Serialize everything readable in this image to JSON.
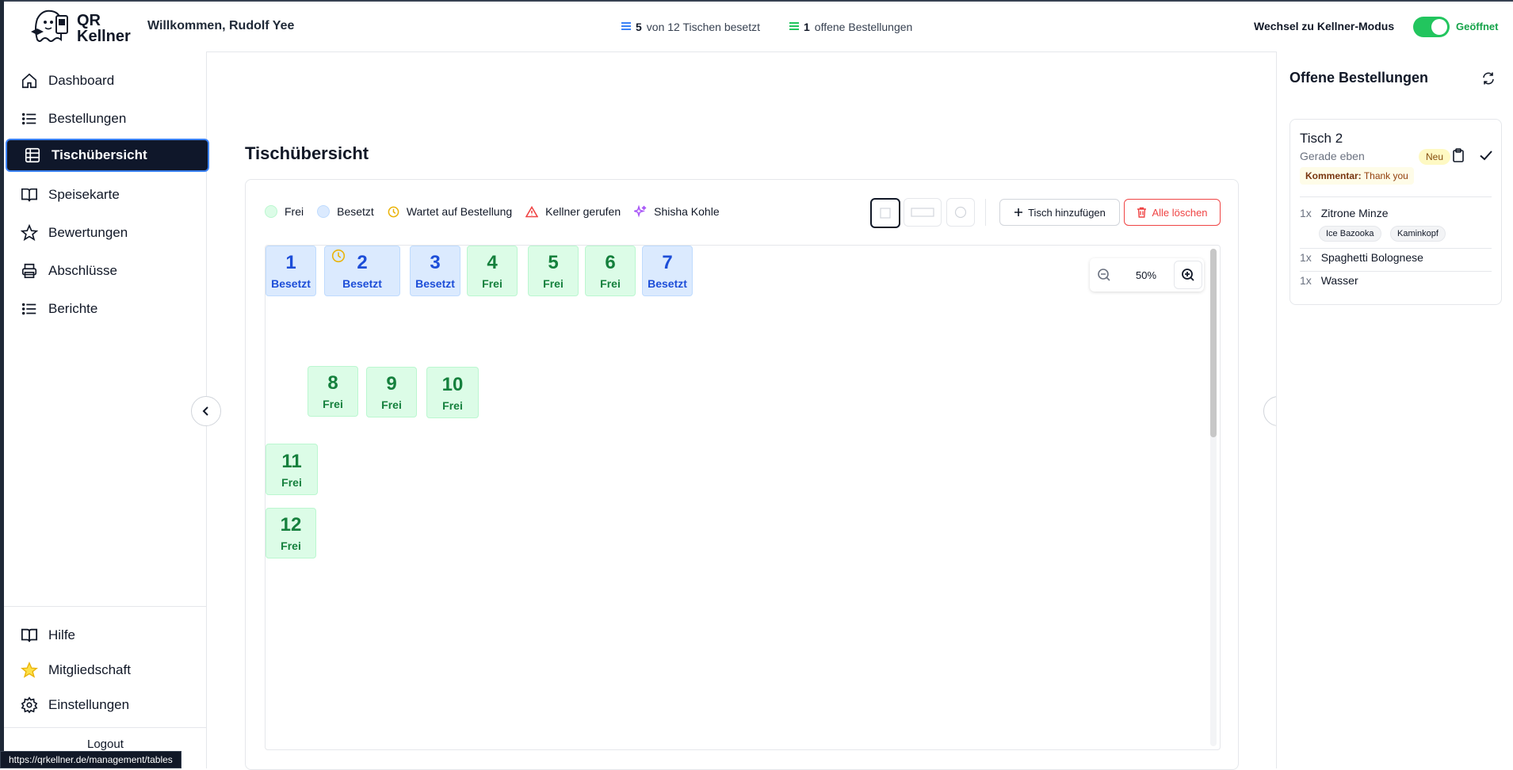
{
  "app": {
    "name": "QR Kellner"
  },
  "header": {
    "welcome": "Willkommen, Rudolf Yee",
    "tables_count": "5",
    "tables_text": "von 12 Tischen besetzt",
    "orders_count": "1",
    "orders_text": "offene Bestellungen",
    "mode_label": "Wechsel zu Kellner-Modus",
    "status_label": "Geöffnet",
    "status_on": true
  },
  "sidebar": {
    "items": [
      {
        "label": "Dashboard",
        "icon": "home-icon"
      },
      {
        "label": "Bestellungen",
        "icon": "list-icon"
      },
      {
        "label": "Tischübersicht",
        "icon": "table-grid-icon",
        "active": true
      },
      {
        "label": "Speisekarte",
        "icon": "book-icon"
      },
      {
        "label": "Bewertungen",
        "icon": "star-icon"
      },
      {
        "label": "Abschlüsse",
        "icon": "printer-icon"
      },
      {
        "label": "Berichte",
        "icon": "list-icon"
      }
    ],
    "bottom_items": [
      {
        "label": "Hilfe",
        "icon": "book-open-icon"
      },
      {
        "label": "Mitgliedschaft",
        "icon": "star-yellow-icon"
      },
      {
        "label": "Einstellungen",
        "icon": "gear-icon"
      }
    ],
    "logout": "Logout"
  },
  "status_url": "https://qrkellner.de/management/tables",
  "main": {
    "title": "Tischübersicht",
    "legend": [
      {
        "label": "Frei",
        "color": "#dcfce7"
      },
      {
        "label": "Besetzt",
        "color": "#dbeafe"
      },
      {
        "label": "Wartet auf Bestellung",
        "icon": "clock-icon",
        "color": "#eab308"
      },
      {
        "label": "Kellner gerufen",
        "icon": "warning-icon",
        "color": "#ef4444"
      },
      {
        "label": "Shisha Kohle",
        "icon": "sparkle-icon",
        "color": "#a855f7"
      }
    ],
    "add_table": "Tisch hinzufügen",
    "delete_all": "Alle löschen",
    "zoom": "50%",
    "tables": [
      {
        "num": "1",
        "status": "Besetzt",
        "state": "busy"
      },
      {
        "num": "2",
        "status": "Besetzt",
        "state": "busy",
        "waiting": true
      },
      {
        "num": "3",
        "status": "Besetzt",
        "state": "busy"
      },
      {
        "num": "4",
        "status": "Frei",
        "state": "free"
      },
      {
        "num": "5",
        "status": "Frei",
        "state": "free"
      },
      {
        "num": "6",
        "status": "Frei",
        "state": "free"
      },
      {
        "num": "7",
        "status": "Besetzt",
        "state": "busy"
      },
      {
        "num": "8",
        "status": "Frei",
        "state": "free"
      },
      {
        "num": "9",
        "status": "Frei",
        "state": "free"
      },
      {
        "num": "10",
        "status": "Frei",
        "state": "free"
      },
      {
        "num": "11",
        "status": "Frei",
        "state": "free"
      },
      {
        "num": "12",
        "status": "Frei",
        "state": "free"
      }
    ]
  },
  "orders_panel": {
    "title": "Offene Bestellungen",
    "order": {
      "table": "Tisch 2",
      "time": "Gerade eben",
      "badge": "Neu",
      "comment_label": "Kommentar:",
      "comment": "Thank you",
      "items": [
        {
          "qty": "1x",
          "name": "Zitrone Minze",
          "extras": [
            "Ice Bazooka",
            "Kaminkopf"
          ]
        },
        {
          "qty": "1x",
          "name": "Spaghetti Bolognese"
        },
        {
          "qty": "1x",
          "name": "Wasser"
        }
      ]
    }
  }
}
